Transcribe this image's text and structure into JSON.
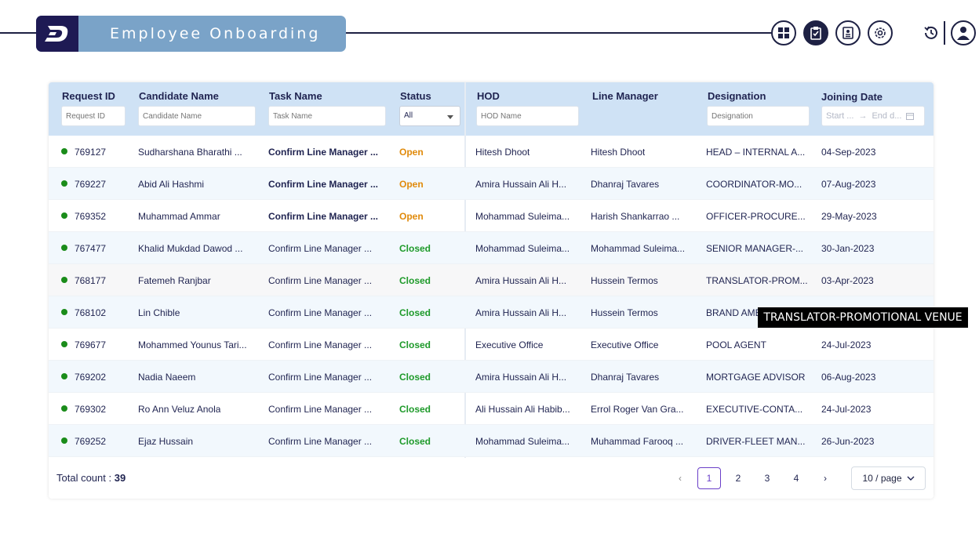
{
  "header": {
    "title": "Employee Onboarding",
    "logo_letter": "D",
    "icons": [
      "dashboard-icon",
      "clipboard-check-icon",
      "document-icon",
      "settings-icon",
      "history-icon",
      "user-icon"
    ]
  },
  "table": {
    "columns": {
      "request_id": "Request ID",
      "candidate": "Candidate Name",
      "task": "Task Name",
      "status": "Status",
      "hod": "HOD",
      "line_manager": "Line Manager",
      "designation": "Designation",
      "joining_date": "Joining Date"
    },
    "filters": {
      "request_id": "Request ID",
      "candidate": "Candidate Name",
      "task": "Task Name",
      "status": "All",
      "hod": "HOD Name",
      "designation": "Designation",
      "date_start": "Start ...",
      "date_sep": "→",
      "date_end": "End d..."
    },
    "rows": [
      {
        "id": "769127",
        "candidate": "Sudharshana Bharathi ...",
        "task": "Confirm Line Manager ...",
        "status": "Open",
        "hod": "Hitesh Dhoot",
        "manager": "Hitesh Dhoot",
        "designation": "HEAD – INTERNAL A...",
        "date": "04-Sep-2023"
      },
      {
        "id": "769227",
        "candidate": "Abid Ali Hashmi",
        "task": "Confirm Line Manager ...",
        "status": "Open",
        "hod": "Amira Hussain Ali H...",
        "manager": "Dhanraj Tavares",
        "designation": "COORDINATOR-MO...",
        "date": "07-Aug-2023"
      },
      {
        "id": "769352",
        "candidate": "Muhammad Ammar",
        "task": "Confirm Line Manager ...",
        "status": "Open",
        "hod": "Mohammad Suleima...",
        "manager": "Harish Shankarrao ...",
        "designation": "OFFICER-PROCURE...",
        "date": "29-May-2023"
      },
      {
        "id": "767477",
        "candidate": "Khalid Mukdad Dawod ...",
        "task": "Confirm Line Manager ...",
        "status": "Closed",
        "hod": "Mohammad Suleima...",
        "manager": "Mohammad Suleima...",
        "designation": "SENIOR MANAGER-...",
        "date": "30-Jan-2023"
      },
      {
        "id": "768177",
        "candidate": "Fatemeh Ranjbar",
        "task": "Confirm Line Manager ...",
        "status": "Closed",
        "hod": "Amira Hussain Ali H...",
        "manager": "Hussein Termos",
        "designation": "TRANSLATOR-PROM...",
        "date": "03-Apr-2023"
      },
      {
        "id": "768102",
        "candidate": "Lin Chible",
        "task": "Confirm Line Manager ...",
        "status": "Closed",
        "hod": "Amira Hussain Ali H...",
        "manager": "Hussein Termos",
        "designation": "BRAND AMB",
        "date": ""
      },
      {
        "id": "769677",
        "candidate": "Mohammed Younus Tari...",
        "task": "Confirm Line Manager ...",
        "status": "Closed",
        "hod": "Executive Office",
        "manager": "Executive Office",
        "designation": "POOL AGENT",
        "date": "24-Jul-2023"
      },
      {
        "id": "769202",
        "candidate": "Nadia Naeem",
        "task": "Confirm Line Manager ...",
        "status": "Closed",
        "hod": "Amira Hussain Ali H...",
        "manager": "Dhanraj Tavares",
        "designation": "MORTGAGE ADVISOR",
        "date": "06-Aug-2023"
      },
      {
        "id": "769302",
        "candidate": "Ro Ann Veluz Anola",
        "task": "Confirm Line Manager ...",
        "status": "Closed",
        "hod": "Ali Hussain Ali Habib...",
        "manager": "Errol Roger Van Gra...",
        "designation": "EXECUTIVE-CONTA...",
        "date": "24-Jul-2023"
      },
      {
        "id": "769252",
        "candidate": "Ejaz Hussain",
        "task": "Confirm Line Manager ...",
        "status": "Closed",
        "hod": "Mohammad Suleima...",
        "manager": "Muhammad Farooq ...",
        "designation": "DRIVER-FLEET MAN...",
        "date": "26-Jun-2023"
      }
    ]
  },
  "footer": {
    "total_label": "Total count : ",
    "total_value": "39",
    "pages": [
      "1",
      "2",
      "3",
      "4"
    ],
    "current_page": "1",
    "page_size": "10 / page"
  },
  "tooltip": "TRANSLATOR-PROMOTIONAL VENUE",
  "colors": {
    "accent": "#6a3fc8",
    "brand": "#1e1a54",
    "header_band": "#7aa3c8",
    "open": "#e08a0b",
    "closed": "#1e9a2a"
  }
}
